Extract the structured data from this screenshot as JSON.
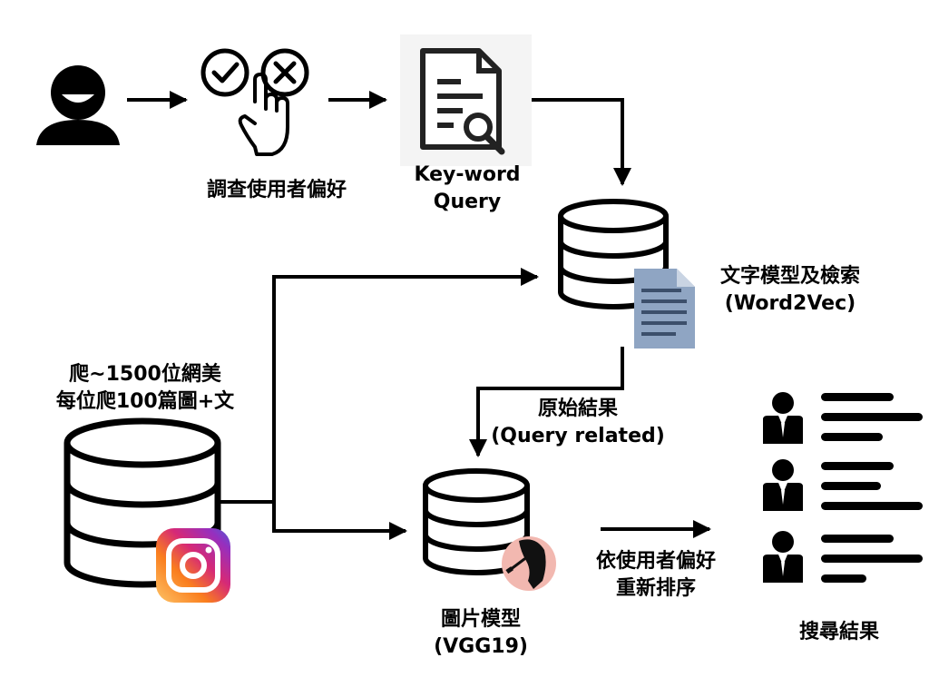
{
  "labels": {
    "survey": "調查使用者偏好",
    "keyword_line1": "Key-word",
    "keyword_line2": "Query",
    "text_model_line1": "文字模型及檢索",
    "text_model_line2": "(Word2Vec)",
    "crawl_line1": "爬~1500位網美",
    "crawl_line2": "每位爬100篇圖+文",
    "raw_line1": "原始結果",
    "raw_line2": "(Query related)",
    "image_model_line1": "圖片模型",
    "image_model_line2": "(VGG19)",
    "rerank_line1": "依使用者偏好",
    "rerank_line2": "重新排序",
    "search_results": "搜尋結果"
  }
}
